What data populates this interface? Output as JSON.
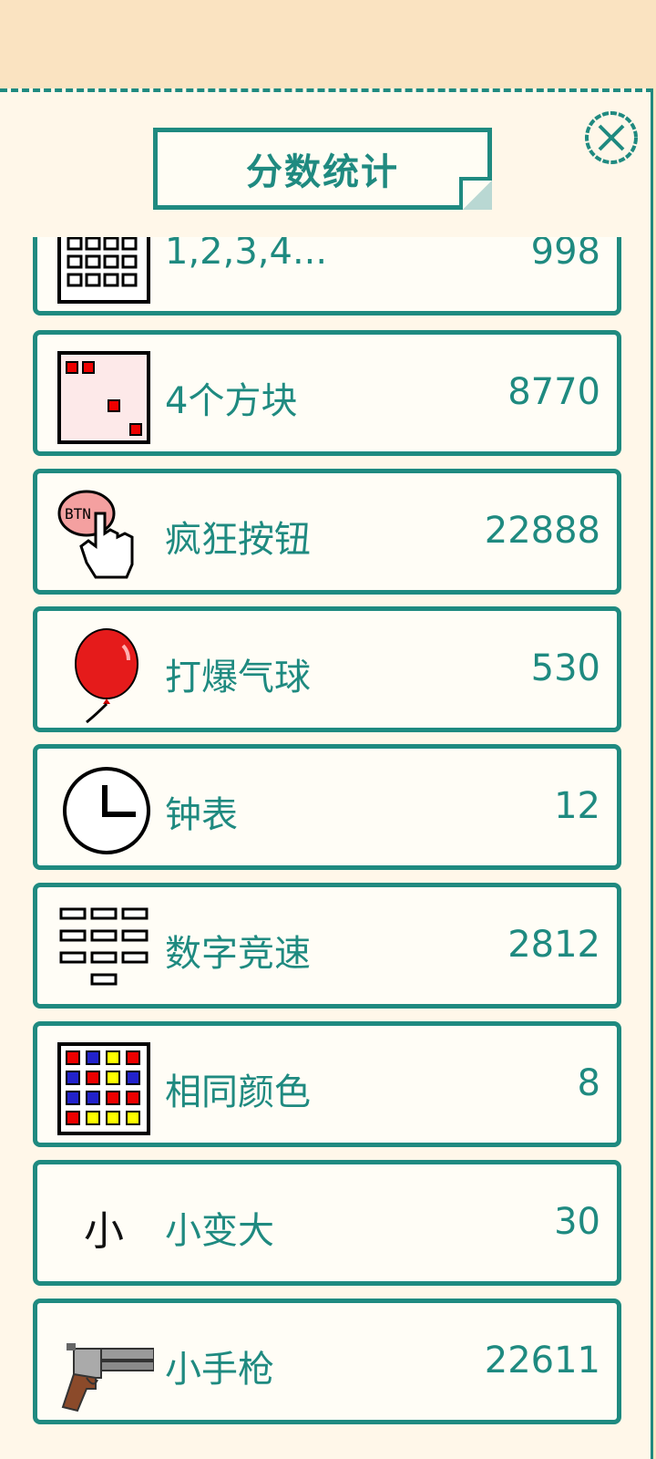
{
  "header": {
    "title": "分数统计",
    "close_icon": "close-icon"
  },
  "colors": {
    "accent": "#1f8a80",
    "panel_bg": "#fff7e9",
    "top_bg": "#fae3c1"
  },
  "stats": [
    {
      "name": "1,2,3,4...",
      "score": "998",
      "icon": "number-grid-icon"
    },
    {
      "name": "4个方块",
      "score": "8770",
      "icon": "four-squares-icon"
    },
    {
      "name": "疯狂按钮",
      "score": "22888",
      "icon": "button-press-icon"
    },
    {
      "name": "打爆气球",
      "score": "530",
      "icon": "balloon-icon"
    },
    {
      "name": "钟表",
      "score": "12",
      "icon": "clock-icon"
    },
    {
      "name": "数字竞速",
      "score": "2812",
      "icon": "keypad-icon"
    },
    {
      "name": "相同颜色",
      "score": "8",
      "icon": "color-grid-icon"
    },
    {
      "name": "小变大",
      "score": "30",
      "icon": "small-big-icon",
      "icon_text": "小"
    },
    {
      "name": "小手枪",
      "score": "22611",
      "icon": "revolver-icon"
    }
  ]
}
